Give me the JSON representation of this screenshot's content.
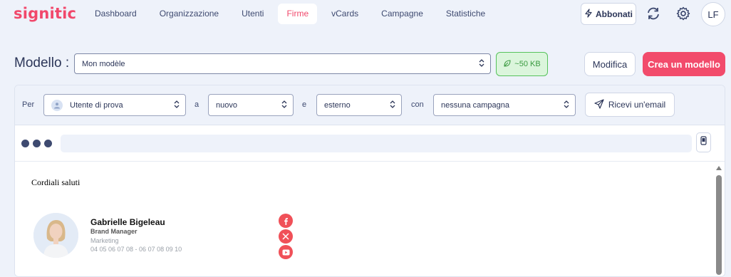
{
  "app": {
    "logo": "signitic"
  },
  "nav": {
    "items": [
      {
        "label": "Dashboard",
        "active": false
      },
      {
        "label": "Organizzazione",
        "active": false
      },
      {
        "label": "Utenti",
        "active": false
      },
      {
        "label": "Firme",
        "active": true
      },
      {
        "label": "vCards",
        "active": false
      },
      {
        "label": "Campagne",
        "active": false
      },
      {
        "label": "Statistiche",
        "active": false
      }
    ],
    "subscribe_label": "Abbonati",
    "avatar_initials": "LF"
  },
  "model": {
    "label": "Modello :",
    "selected": "Mon modèle",
    "size_badge": "~50 KB",
    "edit_label": "Modifica",
    "create_label": "Crea un modello"
  },
  "filters": {
    "per_label": "Per",
    "user_value": "Utente di prova",
    "a_label": "a",
    "recipient_value": "nuovo",
    "e_label": "e",
    "scope_value": "esterno",
    "con_label": "con",
    "campaign_value": "nessuna campagna",
    "send_email_label": "Ricevi un'email"
  },
  "preview": {
    "greeting": "Cordiali saluti",
    "signature": {
      "name": "Gabrielle Bigeleau",
      "role": "Brand Manager",
      "department": "Marketing",
      "phones": "04 05 06 07 08 - 06 07 08 09 10"
    },
    "social_icons": [
      "facebook-icon",
      "x-icon",
      "youtube-icon"
    ]
  },
  "colors": {
    "brand": "#f1486b",
    "accent_green": "#57c25c",
    "text": "#2b3558"
  }
}
